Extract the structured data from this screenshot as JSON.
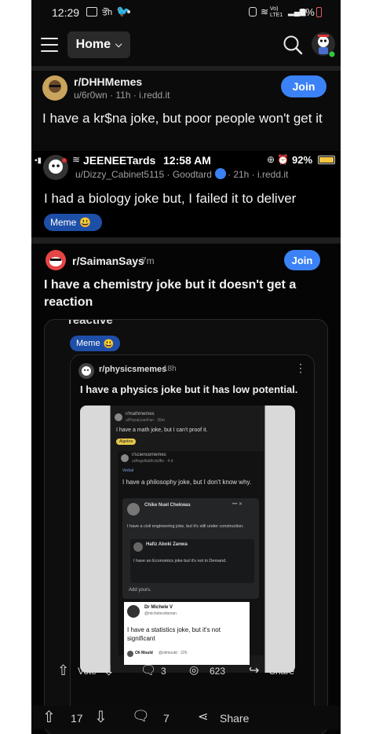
{
  "status": {
    "time": "12:29",
    "left_extra": "ਤੋਂh",
    "right_text": "5%",
    "network": "Vo) LTE1"
  },
  "header": {
    "home_label": "Home"
  },
  "post": {
    "subreddit": "r/DHHMemes",
    "meta": "u/6r0wn · 11h · i.redd.it",
    "join_label": "Join",
    "title": "I have a kr$na joke, but poor people won't get it"
  },
  "level1": {
    "status_left": "JEENEETards",
    "status_time": "12:58 AM",
    "status_battery": "92%",
    "meta_user": "u/Dizzy_Cabinet5115 · Goodtard",
    "meta_time": "· 21h · i.redd.it",
    "title": "I had a biology joke but, I failed it to deliver",
    "flair": "Meme"
  },
  "level2": {
    "subreddit": "r/SaimanSays",
    "age": "7m",
    "join_label": "Join",
    "title": "I have a chemistry joke but it doesn't get a reaction",
    "overflow_word": "reactive",
    "flair": "Meme"
  },
  "level3": {
    "subreddit": "r/physicsmemes",
    "age": "18h",
    "title": "I have a physics joke but it has low potential."
  },
  "level4": {
    "subreddit": "r/mathmemes",
    "user": "u/PizzaLiverFan · 35m",
    "title": "I have a math joke, but I can't proof it.",
    "flair": "Algebra"
  },
  "level5": {
    "subreddit": "r/sciencememes",
    "user": "u/AngelitaMcduffie · 4 d",
    "tag": "Verbal",
    "title": "I have a philosophy joke, but I don't know why."
  },
  "level6": {
    "name": "Chike Nuel Chekwas",
    "body": "I have a civil engineering joke, but it's still under construction.",
    "inner_name": "Hafiz Aboki Zanwa",
    "inner_body": "I have an Economics joke but it's not in Demand.",
    "add": "Add yours."
  },
  "level7": {
    "name": "Dr Michele V",
    "handle": "@michelevidsman",
    "body": "I have a statistics joke, but it's not significant",
    "reply_name": "Oli Mould",
    "reply_handle": "@olimould · 22h"
  },
  "inner_actions": {
    "vote": "Vote",
    "comments": "3",
    "views": "623",
    "share": "Share"
  },
  "bottom": {
    "votes": "17",
    "comments": "7",
    "share": "Share"
  },
  "colors": {
    "background": "#0b0b0b",
    "accent": "#3b82f6",
    "flair": "#1e4fa8"
  }
}
